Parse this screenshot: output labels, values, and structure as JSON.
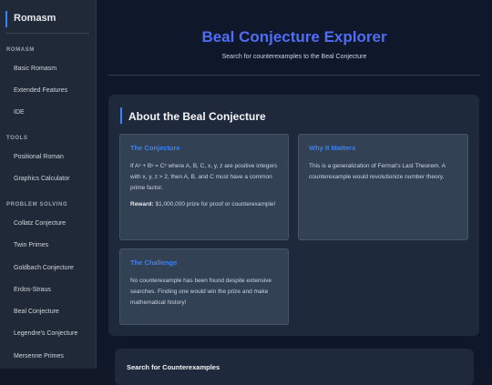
{
  "sidebar": {
    "brand": "Romasm",
    "sections": [
      {
        "label": "ROMASM",
        "items": [
          "Basic Romasm",
          "Extended Features",
          "IDE"
        ]
      },
      {
        "label": "TOOLS",
        "items": [
          "Positional Roman",
          "Graphics Calculator"
        ]
      },
      {
        "label": "PROBLEM SOLVING",
        "items": [
          "Collatz Conjecture",
          "Twin Primes",
          "Goldbach Conjecture",
          "Erdos-Straus",
          "Beal Conjecture",
          "Legendre's Conjecture",
          "Mersenne Primes"
        ]
      }
    ]
  },
  "header": {
    "title": "Beal Conjecture Explorer",
    "subtitle": "Search for counterexamples to the Beal Conjecture"
  },
  "about": {
    "title": "About the Beal Conjecture",
    "conjecture": {
      "title": "The Conjecture",
      "text": "If Aˣ + Bʸ = Cᶻ where A, B, C, x, y, z are positive integers with x, y, z > 2, then A, B, and C must have a common prime factor.",
      "reward_label": "Reward:",
      "reward_text": " $1,000,000 prize for proof or counterexample!"
    },
    "why": {
      "title": "Why It Matters",
      "text": "This is a generalization of Fermat's Last Theorem. A counterexample would revolutionize number theory."
    },
    "challenge": {
      "title": "The Challenge",
      "text": "No counterexample has been found despite extensive searches. Finding one would win the prize and make mathematical history!"
    }
  },
  "search": {
    "title": "Search for Counterexamples"
  }
}
